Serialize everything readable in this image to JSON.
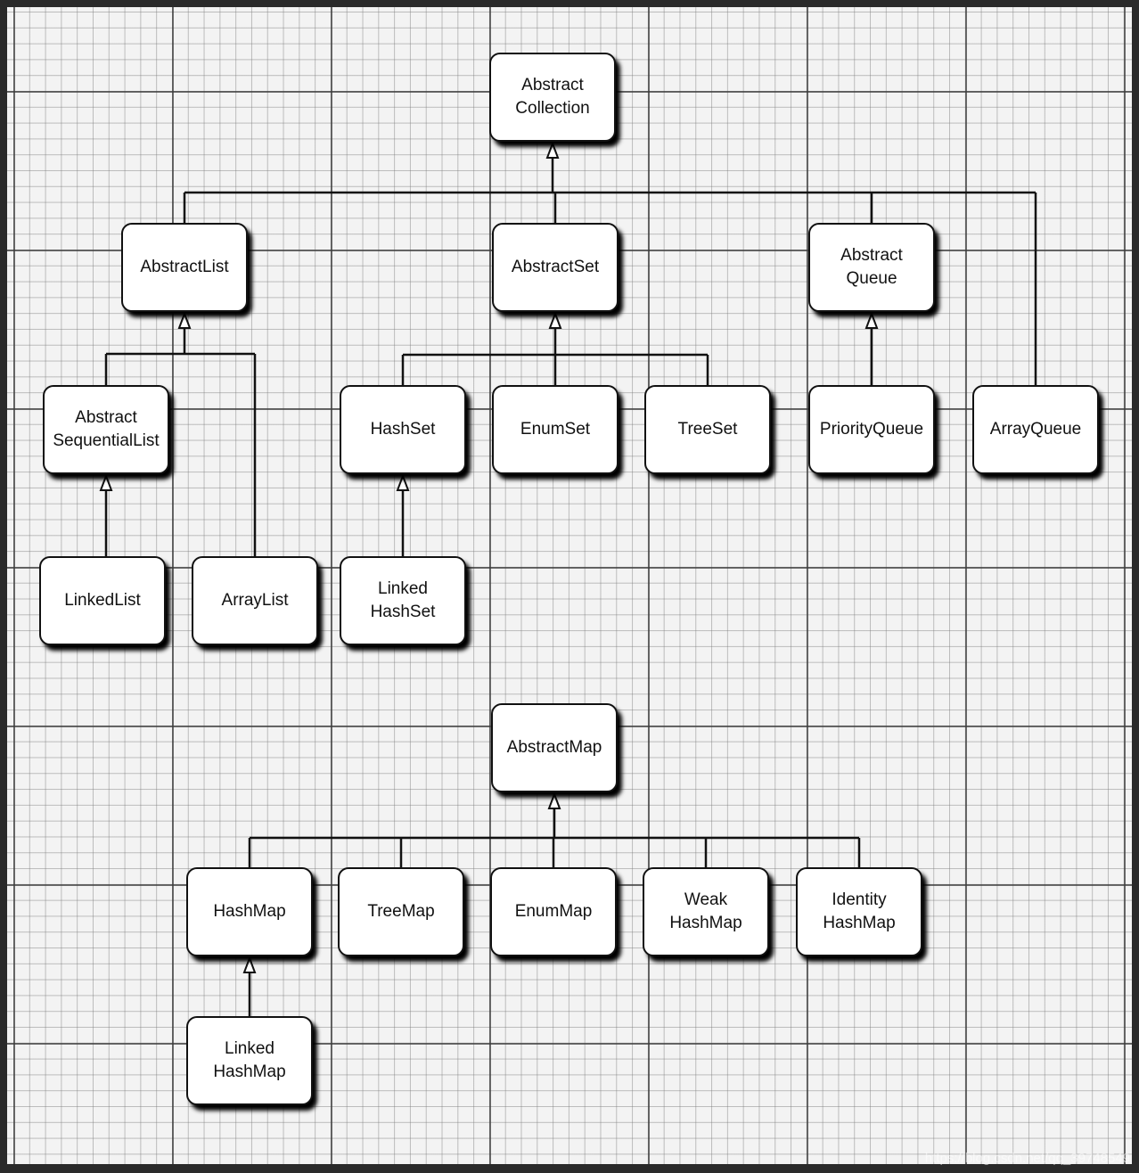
{
  "nodes": {
    "abstract_collection": {
      "l1": "Abstract",
      "l2": "Collection"
    },
    "abstract_list": {
      "l1": "AbstractList"
    },
    "abstract_set": {
      "l1": "AbstractSet"
    },
    "abstract_queue": {
      "l1": "Abstract",
      "l2": "Queue"
    },
    "abstract_sequential_list": {
      "l1": "Abstract",
      "l2": "SequentialList"
    },
    "hash_set": {
      "l1": "HashSet"
    },
    "enum_set": {
      "l1": "EnumSet"
    },
    "tree_set": {
      "l1": "TreeSet"
    },
    "priority_queue": {
      "l1": "PriorityQueue"
    },
    "array_queue": {
      "l1": "ArrayQueue"
    },
    "linked_list": {
      "l1": "LinkedList"
    },
    "array_list": {
      "l1": "ArrayList"
    },
    "linked_hash_set": {
      "l1": "Linked",
      "l2": "HashSet"
    },
    "abstract_map": {
      "l1": "AbstractMap"
    },
    "hash_map": {
      "l1": "HashMap"
    },
    "tree_map": {
      "l1": "TreeMap"
    },
    "enum_map": {
      "l1": "EnumMap"
    },
    "weak_hash_map": {
      "l1": "Weak",
      "l2": "HashMap"
    },
    "identity_hash_map": {
      "l1": "Identity",
      "l2": "HashMap"
    },
    "linked_hash_map": {
      "l1": "Linked",
      "l2": "HashMap"
    }
  },
  "edges": [
    {
      "parent": "abstract_collection",
      "children": [
        "abstract_list",
        "abstract_set",
        "abstract_queue",
        "array_queue"
      ]
    },
    {
      "parent": "abstract_list",
      "children": [
        "abstract_sequential_list",
        "array_list"
      ]
    },
    {
      "parent": "abstract_sequential_list",
      "children": [
        "linked_list"
      ]
    },
    {
      "parent": "abstract_set",
      "children": [
        "hash_set",
        "enum_set",
        "tree_set"
      ]
    },
    {
      "parent": "hash_set",
      "children": [
        "linked_hash_set"
      ]
    },
    {
      "parent": "abstract_queue",
      "children": [
        "priority_queue"
      ]
    },
    {
      "parent": "abstract_map",
      "children": [
        "hash_map",
        "tree_map",
        "enum_map",
        "weak_hash_map",
        "identity_hash_map"
      ]
    },
    {
      "parent": "hash_map",
      "children": [
        "linked_hash_map"
      ]
    }
  ],
  "watermark": "https://blog.csdn.net/qq_39748549"
}
